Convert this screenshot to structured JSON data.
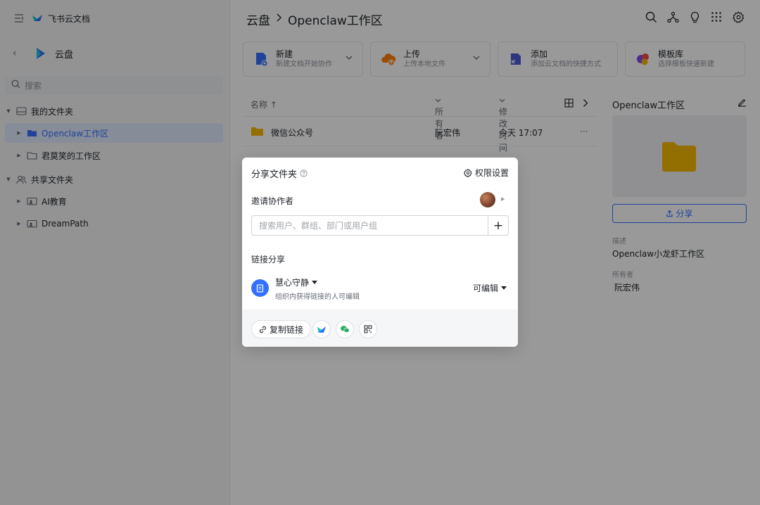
{
  "sidebar": {
    "brand": "飞书云文档",
    "space_name": "云盘",
    "search_placeholder": "搜索",
    "my_folders": "我的文件夹",
    "items": [
      {
        "label": "Openclaw工作区"
      },
      {
        "label": "君莫笑的工作区"
      }
    ],
    "shared_folders": "共享文件夹",
    "shared_items": [
      {
        "label": "AI教育"
      },
      {
        "label": "DreamPath"
      }
    ]
  },
  "header": {
    "breadcrumb_root": "云盘",
    "breadcrumb_current": "Openclaw工作区",
    "icons": [
      "search-icon",
      "org-icon",
      "bulb-icon",
      "apps-grid-icon",
      "gear-icon"
    ]
  },
  "actions": [
    {
      "title": "新建",
      "subtitle": "新建文档开始协作"
    },
    {
      "title": "上传",
      "subtitle": "上传本地文件"
    },
    {
      "title": "添加",
      "subtitle": "添加云文档的快捷方式"
    },
    {
      "title": "模板库",
      "subtitle": "选择模板快速新建"
    }
  ],
  "table": {
    "col_name": "名称 ↑",
    "col_owner": "所有者",
    "col_modified": "修改时间",
    "rows": [
      {
        "name": "微信公众号",
        "owner": "阮宏伟",
        "modified": "今天 17:07",
        "more": "···"
      }
    ]
  },
  "detail": {
    "title": "Openclaw工作区",
    "share_button": "分享",
    "desc_label": "描述",
    "desc_value": "Openclaw小龙虾工作区",
    "owner_label": "所有者",
    "owner_value": "阮宏伟"
  },
  "dialog": {
    "title": "分享文件夹",
    "permission_settings": "权限设置",
    "invite_label": "邀请协作者",
    "invite_placeholder": "搜索用户、群组、部门或用户组",
    "link_share_label": "链接分享",
    "link_scope": "慧心守静",
    "link_scope_desc": "组织内获得链接的人可编辑",
    "link_permission": "可编辑",
    "copy_link": "复制链接"
  },
  "colors": {
    "accent": "#3370ff",
    "folder": "#f5b800",
    "overlay": "rgba(0,0,0,0.40)"
  }
}
